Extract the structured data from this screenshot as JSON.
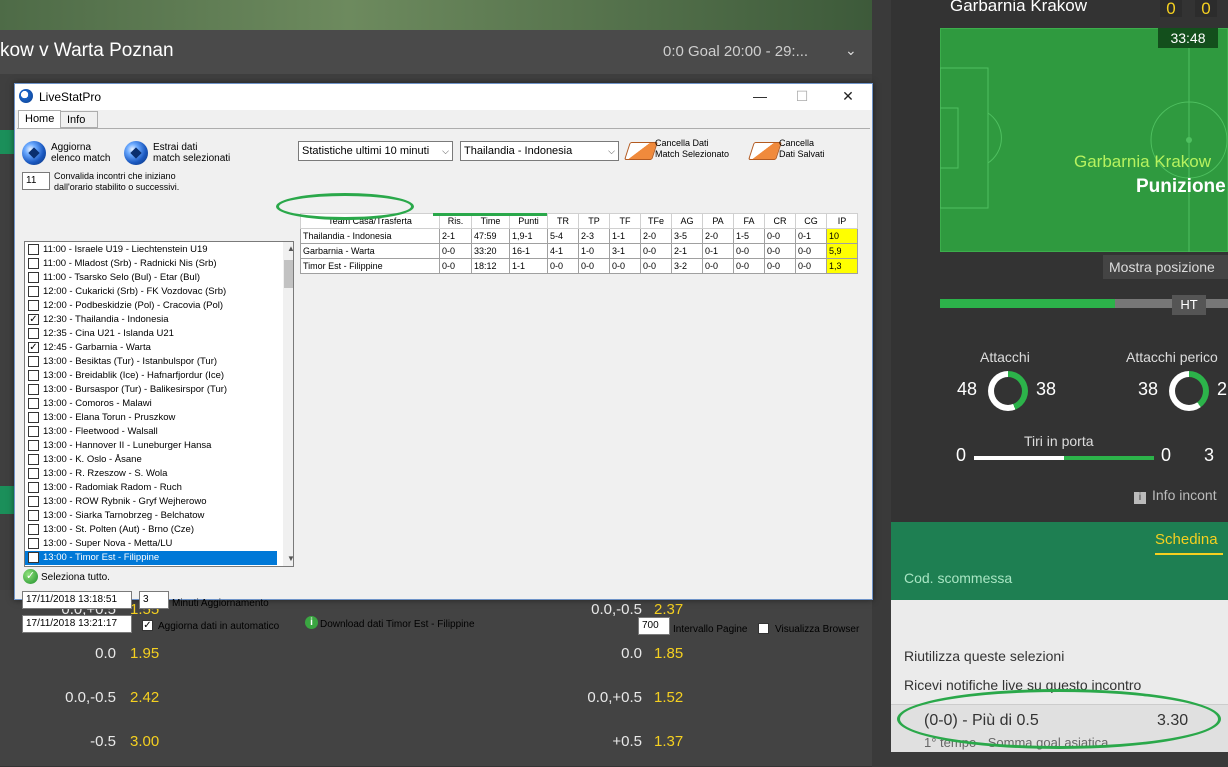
{
  "background": {
    "match_title": "kow v Warta Poznan",
    "match_meta": "0:0 Goal 20:00 - 29:...",
    "odds_rows": [
      {
        "left_line": "0.0,+0.5",
        "left_odds": "1.55",
        "right_line": "0.0,-0.5",
        "right_odds": "2.37"
      },
      {
        "left_line": "0.0",
        "left_odds": "1.95",
        "right_line": "0.0",
        "right_odds": "1.85"
      },
      {
        "left_line": "0.0,-0.5",
        "left_odds": "2.42",
        "right_line": "0.0,+0.5",
        "right_odds": "1.52"
      },
      {
        "left_line": "-0.5",
        "left_odds": "3.00",
        "right_line": "+0.5",
        "right_odds": "1.37"
      }
    ]
  },
  "right_panel": {
    "team": "Garbarnia Krakow",
    "score_home": "0",
    "score_away": "0",
    "clock": "33:48",
    "event_team": "Garbarnia Krakow",
    "event": "Punizione",
    "show_position": "Mostra posizione",
    "ht": "HT",
    "stats": {
      "attacks_label": "Attacchi",
      "attacks_home": "48",
      "attacks_away": "38",
      "dangerous_label": "Attacchi perico",
      "dangerous_home": "38",
      "dangerous_away": "2",
      "shots_label": "Tiri in porta",
      "shots_home": "0",
      "shots_away": "0",
      "extra_num": "3"
    },
    "info": "Info incont",
    "schedina": "Schedina",
    "cod_scommessa": "Cod. scommessa",
    "riutilizza": "Riutilizza queste selezioni",
    "ricevi": "Ricevi notifiche live su questo incontro",
    "bet_label": "(0-0) - Più di 0.5",
    "bet_odds": "3.30",
    "bet_sub": "1° tempo - Somma goal asiatica"
  },
  "window": {
    "title": "LiveStatPro",
    "minimize": "—",
    "maximize": "☐",
    "close": "✕",
    "tabs": [
      "Home",
      "Info"
    ],
    "btn_update_list": "Aggiorna\nelenco match",
    "btn_extract": "Estrai dati\nmatch selezionati",
    "minutes_value": "11",
    "validate_label": "Convalida incontri che iniziano\ndall'orario stabilito o successivi.",
    "matches": [
      {
        "text": "11:00 - Israele U19 - Liechtenstein U19",
        "checked": false,
        "selected": false
      },
      {
        "text": "11:00 - Mladost (Srb) - Radnicki Nis (Srb)",
        "checked": false,
        "selected": false
      },
      {
        "text": "11:00 - Tsarsko Selo (Bul) - Etar (Bul)",
        "checked": false,
        "selected": false
      },
      {
        "text": "12:00 - Cukaricki (Srb) - FK Vozdovac (Srb)",
        "checked": false,
        "selected": false
      },
      {
        "text": "12:00 - Podbeskidzie (Pol) - Cracovia (Pol)",
        "checked": false,
        "selected": false
      },
      {
        "text": "12:30 - Thailandia - Indonesia",
        "checked": true,
        "selected": false
      },
      {
        "text": "12:35 - Cina U21 - Islanda U21",
        "checked": false,
        "selected": false
      },
      {
        "text": "12:45 - Garbarnia - Warta",
        "checked": true,
        "selected": false
      },
      {
        "text": "13:00 - Besiktas (Tur) - Istanbulspor (Tur)",
        "checked": false,
        "selected": false
      },
      {
        "text": "13:00 - Breidablik (Ice) - Hafnarfjordur (Ice)",
        "checked": false,
        "selected": false
      },
      {
        "text": "13:00 - Bursaspor (Tur) - Balikesirspor (Tur)",
        "checked": false,
        "selected": false
      },
      {
        "text": "13:00 - Comoros - Malawi",
        "checked": false,
        "selected": false
      },
      {
        "text": "13:00 - Elana Torun - Pruszkow",
        "checked": false,
        "selected": false
      },
      {
        "text": "13:00 - Fleetwood - Walsall",
        "checked": false,
        "selected": false
      },
      {
        "text": "13:00 - Hannover II - Luneburger Hansa",
        "checked": false,
        "selected": false
      },
      {
        "text": "13:00 - K. Oslo - Åsane",
        "checked": false,
        "selected": false
      },
      {
        "text": "13:00 - R. Rzeszow - S. Wola",
        "checked": false,
        "selected": false
      },
      {
        "text": "13:00 - Radomiak Radom - Ruch",
        "checked": false,
        "selected": false
      },
      {
        "text": "13:00 - ROW Rybnik - Gryf Wejherowo",
        "checked": false,
        "selected": false
      },
      {
        "text": "13:00 - Siarka Tarnobrzeg - Belchatow",
        "checked": false,
        "selected": false
      },
      {
        "text": "13:00 - St. Polten (Aut) - Brno (Cze)",
        "checked": false,
        "selected": false
      },
      {
        "text": "13:00 - Super Nova - Metta/LU",
        "checked": false,
        "selected": false
      },
      {
        "text": "13:00 - Timor Est - Filippine",
        "checked": true,
        "selected": true
      }
    ],
    "select_all": "Seleziona tutto.",
    "datetime1": "17/11/2018 13:18:51",
    "refresh_minutes": "3",
    "refresh_label": "Minuti Aggiornamento",
    "datetime2": "17/11/2018 13:21:17",
    "auto_update_label": "Aggiorna dati  in automatico",
    "download_label": "Download dati Timor Est - Filippine",
    "stats_select": "Statistiche ultimi 10 minuti",
    "match_select": "Thailandia - Indonesia",
    "btn_clear_selected": "Cancella Dati\nMatch Selezionato",
    "btn_clear_saved": "Cancella\nDati Salvati",
    "table_headers": [
      "Team Casa/Trasferta",
      "Ris.",
      "Time",
      "Punti",
      "TR",
      "TP",
      "TF",
      "TFe",
      "AG",
      "PA",
      "FA",
      "CR",
      "CG",
      "IP"
    ],
    "table_rows": [
      [
        "Thailandia - Indonesia",
        "2-1",
        "47:59",
        "1,9-1",
        "5-4",
        "2-3",
        "1-1",
        "2-0",
        "3-5",
        "2-0",
        "1-5",
        "0-0",
        "0-1",
        "10"
      ],
      [
        "Garbarnia - Warta",
        "0-0",
        "33:20",
        "16-1",
        "4-1",
        "1-0",
        "3-1",
        "0-0",
        "2-1",
        "0-1",
        "0-0",
        "0-0",
        "0-0",
        "5,9"
      ],
      [
        "Timor Est - Filippine",
        "0-0",
        "18:12",
        "1-1",
        "0-0",
        "0-0",
        "0-0",
        "0-0",
        "3-2",
        "0-0",
        "0-0",
        "0-0",
        "0-0",
        "1,3"
      ]
    ],
    "page_interval_value": "700",
    "page_interval_label": "Intervallo Pagine",
    "show_browser_label": "Visualizza Browser"
  }
}
